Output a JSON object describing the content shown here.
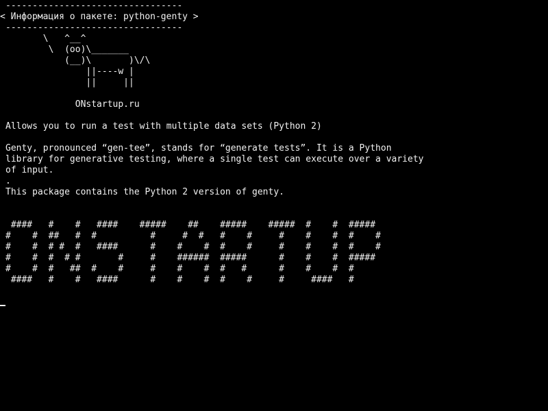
{
  "bubble": {
    "top_border": "---------------------------------",
    "title": "< Информация о пакете: python-genty >",
    "bottom_border": "---------------------------------"
  },
  "cow": {
    "lines": [
      "       \\   ^__^",
      "        \\  (oo)\\_______",
      "           (__)\\       )\\/\\",
      "               ||----w |",
      "               ||     ||"
    ]
  },
  "site": "             ONstartup.ru",
  "package": {
    "summary": "Allows you to run a test with multiple data sets (Python 2)",
    "description_lines": [
      "Genty, pronounced “gen-tee”, stands for “generate tests”. It is a Python",
      "library for generative testing, where a single test can execute over a variety",
      "of input."
    ],
    "separator": ".",
    "note": "This package contains the Python 2 version of genty."
  },
  "banner": {
    "lines": [
      " ####   #    #   ####    #####    ##    #####    #####  #    #  #####",
      "#    #  ##   #  #          #     #  #   #    #     #    #    #  #    #",
      "#    #  # #  #   ####      #    #    #  #    #     #    #    #  #    #",
      "#    #  #  # #       #     #    ######  #####      #    #    #  #####",
      "#    #  #   ##  #    #     #    #    #  #   #      #    #    #  #",
      " ####   #    #   ####      #    #    #  #    #     #     ####   #"
    ]
  }
}
